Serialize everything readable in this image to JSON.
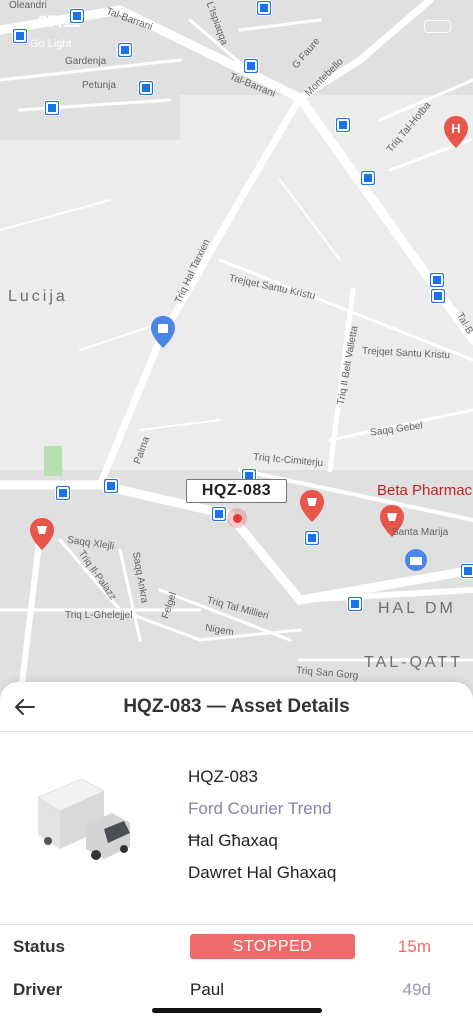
{
  "status_bar": {
    "time": "07:11",
    "subtitle": "Go Light"
  },
  "map": {
    "streets": [
      "Tal-Barrani",
      "Tal-Barrani",
      "Gardenja",
      "Petunja",
      "Oleandri",
      "L'Ispiaqqa",
      "G Faure",
      "Montebello",
      "Triq Tal-Hotba",
      "Triq Hal Tarxien",
      "Trejqet Santu Kristu",
      "Trejqet Santu Kristu",
      "Triq Il Belt Valletta",
      "Saqq Gebel",
      "Triq Ic-Cimiterju",
      "Palma",
      "Saqq Xlejli",
      "Triq Il-Palazz",
      "Saqq Ankra",
      "Triq L-Ghelejjel",
      "Felgel",
      "Triq Tal Millieri",
      "Nigem",
      "Santa Marija",
      "Triq San Gorg",
      "Tal-B"
    ],
    "districts": [
      "Lucija",
      "HAL DM",
      "TAL-QATT"
    ],
    "places": [
      "Beta Pharmac"
    ],
    "marker_label": "HQZ-083",
    "colors": {
      "bus_stop": "#1a73e8",
      "pin": "#e8554b",
      "marker": "#e53935"
    }
  },
  "panel": {
    "title": "HQZ-083 — Asset Details",
    "back_icon": "arrow-left-icon",
    "asset": {
      "plate": "HQZ-083",
      "model": "Ford Courier Trend",
      "locality": "Ħal Għaxaq",
      "address": "Dawret Hal Ghaxaq",
      "icon": "truck-icon"
    },
    "status": {
      "label": "Status",
      "value": "STOPPED",
      "duration": "15m",
      "color": "#ef6b6b"
    },
    "driver": {
      "label": "Driver",
      "value": "Paul",
      "duration": "49d",
      "duration_color": "#9a96b5"
    }
  }
}
